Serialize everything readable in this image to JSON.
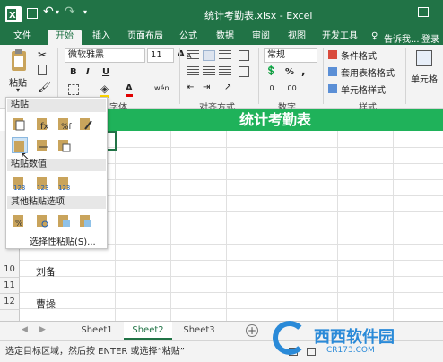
{
  "window": {
    "title": "统计考勤表.xlsx - Excel",
    "qat": {
      "undo": "↶",
      "redo": "↷"
    }
  },
  "ribbon_tabs": [
    "文件",
    "开始",
    "插入",
    "页面布局",
    "公式",
    "数据",
    "审阅",
    "视图",
    "开发工具"
  ],
  "search": {
    "text": "告诉我..."
  },
  "account": "登录",
  "ribbon": {
    "paste_label": "粘贴",
    "font_name": "微软雅黑",
    "font_size": "11",
    "bold": "B",
    "italic": "I",
    "underline": "U",
    "grow_font": "A",
    "shrink_font": "A",
    "font_color": "A",
    "wen": "wén",
    "number_format": "常规",
    "percent": "%",
    "comma": ",",
    "conditional_format": "条件格式",
    "table_format": "套用表格格式",
    "cell_style": "单元格样式",
    "cells_label": "单元格",
    "group_font": "字体",
    "group_align": "对齐方式",
    "group_number": "数字",
    "group_style": "样式"
  },
  "banner": {
    "title": "统计考勤表"
  },
  "paste_menu": {
    "section_paste": "粘贴",
    "section_values": "粘贴数值",
    "section_other": "其他粘贴选项",
    "special": "选择性粘贴(S)..."
  },
  "rows": [
    {
      "num": "10",
      "name": "刘备"
    },
    {
      "num": "11",
      "name": ""
    },
    {
      "num": "12",
      "name": "曹操"
    }
  ],
  "sheets": [
    "Sheet1",
    "Sheet2",
    "Sheet3"
  ],
  "status": {
    "message": "选定目标区域，然后按 ENTER 或选择“粘贴”"
  },
  "watermark": {
    "text": "西西软件园",
    "url": "CR173.COM"
  },
  "colors": {
    "accent": "#217346",
    "banner": "#1fb25a"
  }
}
